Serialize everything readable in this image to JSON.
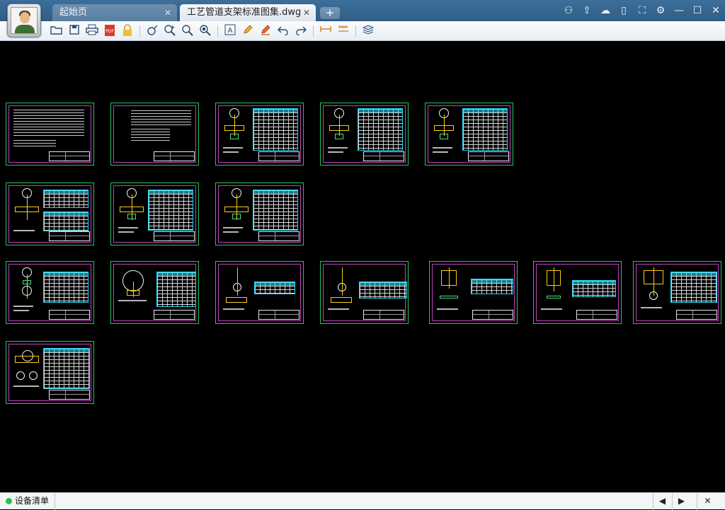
{
  "tabs": {
    "home": {
      "label": "起始页",
      "close": "✕"
    },
    "drawing": {
      "label": "工艺管道支架标准图集.dwg",
      "close": "✕"
    },
    "add": "+"
  },
  "window_controls": [
    "users-icon",
    "share-icon",
    "wechat-icon",
    "phone-icon",
    "fullscreen-icon",
    "settings-icon",
    "minimize-icon",
    "maximize-icon",
    "close-icon"
  ],
  "toolbar": {
    "buttons": [
      {
        "name": "open-folder-icon",
        "glyph": "▭"
      },
      {
        "name": "save-icon",
        "glyph": "▣"
      },
      {
        "name": "print-icon",
        "glyph": "⎙"
      },
      {
        "name": "pdf-export-icon",
        "glyph": "PDF"
      },
      {
        "name": "lock-icon",
        "glyph": "🔒"
      },
      {
        "name": "pan-icon",
        "glyph": "✥"
      },
      {
        "name": "zoom-window-icon",
        "glyph": "⊕"
      },
      {
        "name": "zoom-icon",
        "glyph": "⌕"
      },
      {
        "name": "zoom-extents-icon",
        "glyph": "⌖"
      },
      {
        "name": "text-icon",
        "glyph": "A"
      },
      {
        "name": "pencil-icon",
        "glyph": "✎"
      },
      {
        "name": "highlighter-icon",
        "glyph": "✐"
      },
      {
        "name": "undo-icon",
        "glyph": "↶"
      },
      {
        "name": "redo-icon",
        "glyph": "↷"
      },
      {
        "name": "measure-icon",
        "glyph": "⟷"
      },
      {
        "name": "dimension-icon",
        "glyph": "⋙"
      },
      {
        "name": "layers-icon",
        "glyph": "≋"
      }
    ]
  },
  "statusbar": {
    "label": "设备清单",
    "prev": "◀",
    "next": "▶",
    "close": "✕"
  }
}
